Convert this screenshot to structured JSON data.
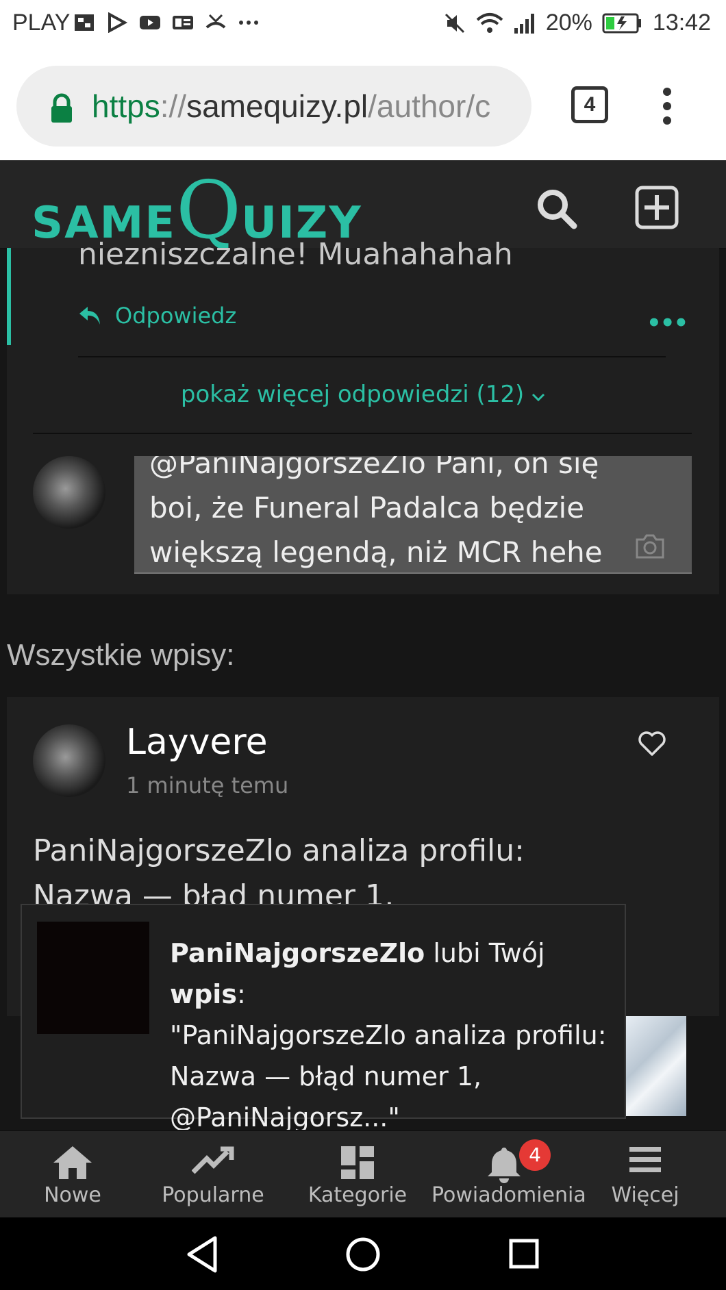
{
  "status_bar": {
    "carrier": "PLAY",
    "battery": "20%",
    "time": "13:42"
  },
  "browser": {
    "url_scheme": "https",
    "url_separator": "://",
    "url_host": "samequizy.pl",
    "url_path": "/author/c",
    "tab_count": "4"
  },
  "site": {
    "logo_small_1": "SAME",
    "logo_big": "Q",
    "logo_small_2": "UIZY"
  },
  "reply_thread": {
    "cut_text": "niezniszczalne! Muahahahah",
    "reply_label": "Odpowiedz",
    "more_dots": "•••",
    "show_more": "pokaż więcej odpowiedzi (12)",
    "comment_text": "@PaniNajgorszeZlo Pani, on się boi, że Funeral Padalca będzie większą legendą, niż MCR hehe"
  },
  "all_posts_heading": "Wszystkie wpisy:",
  "post": {
    "author": "Layvere",
    "time": "1 minutę temu",
    "text_line1": "PaniNajgorszeZlo analiza profilu:",
    "text_line2": "Nazwa — błąd numer 1,"
  },
  "toast": {
    "user": "PaniNajgorszeZlo",
    "action": " lubi Twój ",
    "object": "wpis",
    "colon": ":",
    "quote": "\"PaniNajgorszeZlo analiza profilu: Nazwa — błąd numer 1, @PaniNajgorsz...\""
  },
  "bottom_nav": {
    "items": [
      {
        "label": "Nowe",
        "icon": "home-icon"
      },
      {
        "label": "Popularne",
        "icon": "trending-icon"
      },
      {
        "label": "Kategorie",
        "icon": "dashboard-icon"
      },
      {
        "label": "Powiadomienia",
        "icon": "bell-icon"
      },
      {
        "label": "Więcej",
        "icon": "menu-icon"
      }
    ],
    "notification_badge": "4"
  },
  "colors": {
    "accent": "#2bbfa4",
    "header_bg": "#252525",
    "page_bg": "#161616",
    "badge": "#e53935"
  }
}
